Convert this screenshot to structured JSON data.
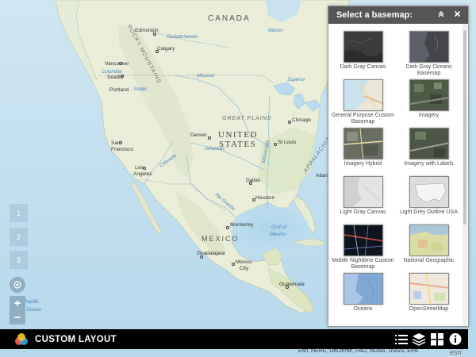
{
  "map": {
    "labels": {
      "canada": "CANADA",
      "united_states_1": "UNITED",
      "united_states_2": "STATES",
      "mexico": "MEXICO",
      "great_plains": "GREAT PLAINS",
      "rocky_mountains": "ROCKY MOUNTAINS",
      "appalachian": "APPALACHIAN",
      "pacific_ocean_1": "Pacific",
      "pacific_ocean_2": "Ocean",
      "gulf_1": "Gulf of",
      "gulf_2": "Mexico",
      "missouri": "Missouri",
      "arkansas": "Arkansas",
      "colorado": "Colorado",
      "mississippi": "Mississippi",
      "rio_grande": "Rio Grande",
      "snake": "Snake",
      "saskatchewan": "Saskatchewan",
      "columbia": "Columbia",
      "nelson": "Nelson",
      "superior": "Superior"
    },
    "cities": {
      "edmonton": "Edmonton",
      "calgary": "Calgary",
      "vancouver": "Vancouver",
      "seattle": "Seattle",
      "portland": "Portland",
      "san_francisco_1": "San",
      "san_francisco_2": "Francisco",
      "los_angeles_1": "Los",
      "los_angeles_2": "Angeles",
      "denver": "Denver",
      "chicago": "Chicago",
      "st_louis": "St Louis",
      "dallas": "Dallas",
      "houston": "Houston",
      "monterrey": "Monterrey",
      "guadalajara": "Guadalajara",
      "mexico_city_1": "México",
      "mexico_city_2": "City",
      "guatemala": "Guatemala",
      "atlanta": "Atlan"
    },
    "nav": {
      "page1": "1",
      "page2": "2",
      "page3": "3",
      "zoom_in": "+",
      "zoom_out": "−"
    }
  },
  "panel": {
    "title": "Select a basemap:",
    "collapse_icon": "double-chevron-up-icon",
    "close_icon": "close-icon",
    "basemaps": [
      {
        "label": "Dark Gray Canvas",
        "thumb": "dark-gray"
      },
      {
        "label": "Dark Gray Oceans Basemap",
        "thumb": "dark-oceans"
      },
      {
        "label": "General Purpose Custom Basemap",
        "thumb": "general"
      },
      {
        "label": "Imagery",
        "thumb": "imagery"
      },
      {
        "label": "Imagery Hybrid",
        "thumb": "imagery-hybrid"
      },
      {
        "label": "Imagery with Labels",
        "thumb": "imagery-labels"
      },
      {
        "label": "Light Gray Canvas",
        "thumb": "light-gray"
      },
      {
        "label": "Light Grey Outline USA",
        "thumb": "light-grey-outline"
      },
      {
        "label": "Mobile Nighttime Custom Basemap",
        "thumb": "nighttime"
      },
      {
        "label": "National Geographic",
        "thumb": "natgeo"
      },
      {
        "label": "Oceans",
        "thumb": "oceans"
      },
      {
        "label": "OpenStreetMap",
        "thumb": "osm"
      }
    ]
  },
  "bottombar": {
    "title": "CUSTOM LAYOUT",
    "icons": [
      "legend-icon",
      "layers-icon",
      "basemap-grid-icon",
      "info-icon"
    ]
  },
  "attribution": "Esri, HERE, DeLorme, FAO, NOAA, USGS, EPA",
  "esri_logo": "esri",
  "colors": {
    "ocean": "#bfe0f0",
    "land": "#eef0e2",
    "panel_header": "#565656",
    "bottom_bar": "#000000"
  }
}
